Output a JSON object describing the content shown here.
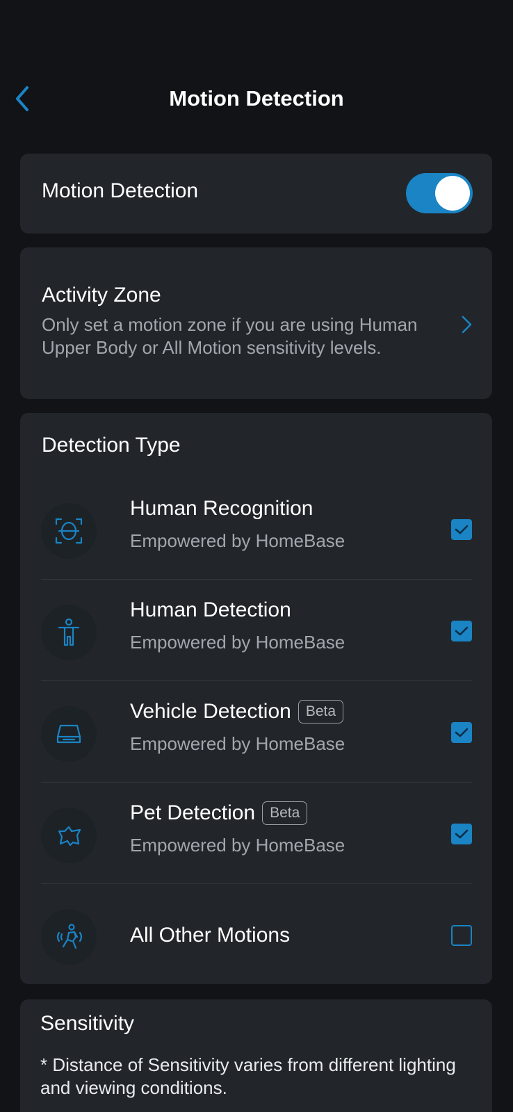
{
  "header": {
    "title": "Motion Detection",
    "back_icon": "chevron-left-icon"
  },
  "motion_card": {
    "label": "Motion Detection",
    "enabled": true
  },
  "activity_zone": {
    "title": "Activity Zone",
    "description": "Only set a motion zone if you are using Human Upper Body or All Motion sensitivity levels.",
    "chevron_icon": "chevron-right-icon"
  },
  "detection_type": {
    "title": "Detection Type",
    "items": [
      {
        "name": "Human Recognition",
        "subtitle": "Empowered by HomeBase",
        "badge": "",
        "checked": true,
        "icon": "face-scan-icon"
      },
      {
        "name": "Human Detection",
        "subtitle": "Empowered by HomeBase",
        "badge": "",
        "checked": true,
        "icon": "person-icon"
      },
      {
        "name": "Vehicle Detection",
        "subtitle": "Empowered by HomeBase",
        "badge": "Beta",
        "checked": true,
        "icon": "car-icon"
      },
      {
        "name": "Pet Detection",
        "subtitle": "Empowered by HomeBase",
        "badge": "Beta",
        "checked": true,
        "icon": "pet-icon"
      },
      {
        "name": "All Other Motions",
        "subtitle": "",
        "badge": "",
        "checked": false,
        "icon": "motion-person-icon"
      }
    ]
  },
  "sensitivity": {
    "title": "Sensitivity",
    "note": "* Distance of Sensitivity varies from different lighting and viewing conditions."
  },
  "colors": {
    "accent": "#1a84c4",
    "background": "#111316",
    "card": "#22262b",
    "secondary_text": "#a3a7ad"
  }
}
